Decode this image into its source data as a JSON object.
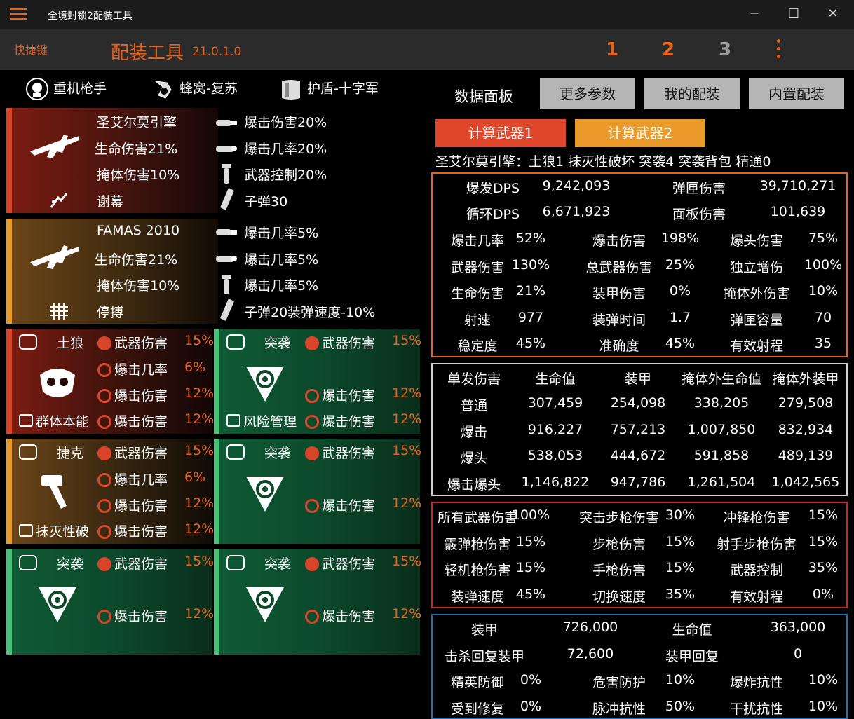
{
  "window": {
    "title": "全境封锁2配装工具",
    "controls": {
      "minimize": "─",
      "maximize": "☐",
      "close": "✕"
    }
  },
  "header": {
    "shortcut_label": "快捷键",
    "app_title": "配装工具",
    "version": "21.0.1.0",
    "pages": [
      {
        "label": "1",
        "color": "#e8621c"
      },
      {
        "label": "2",
        "color": "#e8621c"
      },
      {
        "label": "3",
        "color": "#9a9a9a"
      }
    ]
  },
  "specs": [
    {
      "icon": "gunner-icon",
      "label": "重机枪手"
    },
    {
      "icon": "hive-icon",
      "label": "蜂窝-复苏"
    },
    {
      "icon": "shield-icon",
      "label": "护盾-十字军"
    }
  ],
  "weapons": [
    {
      "name": "圣艾尔莫引擎",
      "stat1": "生命伤害21%",
      "stat2": "掩体伤害10%",
      "talent": "谢幕",
      "attrs": [
        "爆击伤害20%",
        "爆击几率20%",
        "武器控制20%",
        "子弹30"
      ]
    },
    {
      "name": "FAMAS 2010",
      "stat1": "生命伤害21%",
      "stat2": "掩体伤害10%",
      "talent": "停搏",
      "attrs": [
        "爆击几率5%",
        "爆击几率5%",
        "爆击几率5%",
        "子弹20装弹速度-10%"
      ]
    }
  ],
  "gear": [
    {
      "brand": "土狼",
      "talent": "群体本能",
      "rows": [
        [
          "武器伤害",
          "15%"
        ],
        [
          "爆击几率",
          "6%"
        ],
        [
          "爆击伤害",
          "12%"
        ],
        [
          "爆击伤害",
          "12%"
        ]
      ]
    },
    {
      "brand": "突袭",
      "talent": "风险管理",
      "rows": [
        [
          "武器伤害",
          "15%"
        ],
        [
          "",
          ""
        ],
        [
          "爆击伤害",
          "12%"
        ],
        [
          "爆击伤害",
          "12%"
        ]
      ]
    },
    {
      "brand": "捷克",
      "talent": "抹灭性破",
      "rows": [
        [
          "武器伤害",
          "15%"
        ],
        [
          "爆击几率",
          "6%"
        ],
        [
          "爆击伤害",
          "12%"
        ],
        [
          "爆击伤害",
          "12%"
        ]
      ]
    },
    {
      "brand": "突袭",
      "talent": "",
      "rows": [
        [
          "武器伤害",
          "15%"
        ],
        [
          "",
          ""
        ],
        [
          "爆击伤害",
          "12%"
        ],
        [
          "",
          ""
        ]
      ]
    },
    {
      "brand": "突袭",
      "talent": "",
      "rows": [
        [
          "武器伤害",
          "15%"
        ],
        [
          "",
          ""
        ],
        [
          "爆击伤害",
          "12%"
        ],
        [
          "",
          ""
        ]
      ]
    },
    {
      "brand": "突袭",
      "talent": "",
      "rows": [
        [
          "武器伤害",
          "15%"
        ],
        [
          "",
          ""
        ],
        [
          "爆击伤害",
          "12%"
        ],
        [
          "",
          ""
        ]
      ]
    }
  ],
  "panel": {
    "label": "数据面板",
    "buttons": [
      "更多参数",
      "我的配装",
      "内置配装"
    ],
    "calc1": "计算武器1",
    "calc2": "计算武器2",
    "build_line": "圣艾尔莫引擎：土狼1 抹灭性破坏 突袭4 突袭背包  精通0"
  },
  "stats_orange": [
    [
      "爆发DPS",
      "9,242,093",
      "弹匣伤害",
      "39,710,271"
    ],
    [
      "循环DPS",
      "6,671,923",
      "面板伤害",
      "101,639"
    ]
  ],
  "stats_orange_grid": [
    [
      "爆击几率",
      "52%",
      "爆击伤害",
      "198%",
      "爆头伤害",
      "75%"
    ],
    [
      "武器伤害",
      "130%",
      "总武器伤害",
      "25%",
      "独立增伤",
      "100%"
    ],
    [
      "生命伤害",
      "21%",
      "装甲伤害",
      "0%",
      "掩体外伤害",
      "10%"
    ],
    [
      "射速",
      "977",
      "装弹时间",
      "1.7",
      "弹匣容量",
      "70"
    ],
    [
      "稳定度",
      "45%",
      "准确度",
      "45%",
      "有效射程",
      "35"
    ]
  ],
  "damage_table": {
    "headers": [
      "单发伤害",
      "生命值",
      "装甲",
      "掩体外生命值",
      "掩体外装甲"
    ],
    "rows": [
      [
        "普通",
        "307,459",
        "254,098",
        "338,205",
        "279,508"
      ],
      [
        "爆击",
        "916,227",
        "757,213",
        "1,007,850",
        "832,934"
      ],
      [
        "爆头",
        "538,053",
        "444,672",
        "591,858",
        "489,139"
      ],
      [
        "爆击爆头",
        "1,146,822",
        "947,786",
        "1,261,504",
        "1,042,565"
      ]
    ]
  },
  "weapon_bonus": [
    [
      "所有武器伤害",
      "100%",
      "突击步枪伤害",
      "30%",
      "冲锋枪伤害",
      "15%"
    ],
    [
      "霰弹枪伤害",
      "15%",
      "步枪伤害",
      "15%",
      "射手步枪伤害",
      "15%"
    ],
    [
      "轻机枪伤害",
      "15%",
      "手枪伤害",
      "15%",
      "武器控制",
      "35%"
    ],
    [
      "装弹速度",
      "45%",
      "切换速度",
      "35%",
      "有效射程",
      "0%"
    ]
  ],
  "defense_top": [
    [
      "装甲",
      "726,000",
      "生命值",
      "363,000"
    ],
    [
      "击杀回复装甲",
      "72,600",
      "装甲回复",
      "0"
    ]
  ],
  "defense_grid": [
    [
      "精英防御",
      "0%",
      "危害防护",
      "10%",
      "爆炸抗性",
      "10%"
    ],
    [
      "受到修复",
      "0%",
      "脉冲抗性",
      "50%",
      "干扰抗性",
      "10%"
    ]
  ]
}
